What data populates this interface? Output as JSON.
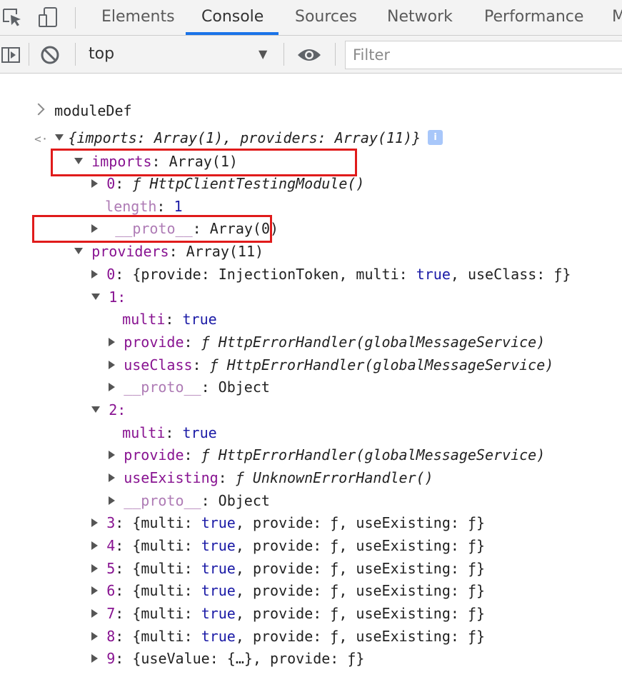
{
  "tabs": [
    {
      "label": "Elements"
    },
    {
      "label": "Console"
    },
    {
      "label": "Sources"
    },
    {
      "label": "Network"
    },
    {
      "label": "Performance"
    },
    {
      "label": "M"
    }
  ],
  "active_tab": "Console",
  "toolbar": {
    "context": "top",
    "filter_placeholder": "Filter"
  },
  "console": {
    "input_command": "moduleDef",
    "result_summary": "{imports: Array(1), providers: Array(11)}",
    "info_badge": "i",
    "lines": {
      "imports_key": "imports",
      "imports_val": ": Array(1)",
      "imp0_index": "0",
      "imp0_fn": "ƒ HttpClientTestingModule()",
      "length_key": "length",
      "length_val": "1",
      "proto_key": "__proto__",
      "proto_val": ": Array(0)",
      "providers_key": "providers",
      "providers_val": ": Array(11)",
      "p0_index": "0",
      "p0_text_a": "{provide: InjectionToken, multi: ",
      "p0_true": "true",
      "p0_text_b": ", useClass: ƒ}",
      "p1_index": "1:",
      "p1_multi_key": "multi",
      "p1_multi_val": "true",
      "p1_provide_key": "provide",
      "p1_provide_val": "ƒ HttpErrorHandler(globalMessageService)",
      "p1_useclass_key": "useClass",
      "p1_useclass_val": "ƒ HttpErrorHandler(globalMessageService)",
      "p1_proto_key": "__proto__",
      "p1_proto_val": ": Object",
      "p2_index": "2:",
      "p2_multi_key": "multi",
      "p2_multi_val": "true",
      "p2_provide_key": "provide",
      "p2_provide_val": "ƒ HttpErrorHandler(globalMessageService)",
      "p2_useexisting_key": "useExisting",
      "p2_useexisting_val": "ƒ UnknownErrorHandler()",
      "p2_proto_key": "__proto__",
      "p2_proto_val": ": Object",
      "collapsed_text_a": ": {multi: ",
      "collapsed_true": "true",
      "collapsed_text_b": ", provide: ƒ, useExisting: ƒ}",
      "p3_index": "3",
      "p4_index": "4",
      "p5_index": "5",
      "p6_index": "6",
      "p7_index": "7",
      "p8_index": "8",
      "p9_index": "9",
      "p9_text": ": {useValue: {…}, provide: ƒ}"
    }
  },
  "colors": {
    "highlight_border": "#e01b1b",
    "active_tab_underline": "#1a73e8",
    "property_key": "#881391",
    "keyword_value": "#1a1aa6"
  },
  "icons": [
    "inspect-element-icon",
    "device-toolbar-icon",
    "show-sidebar-icon",
    "clear-console-icon",
    "live-expression-eye-icon",
    "console-input-chevron-icon",
    "console-result-arrow-icon"
  ]
}
